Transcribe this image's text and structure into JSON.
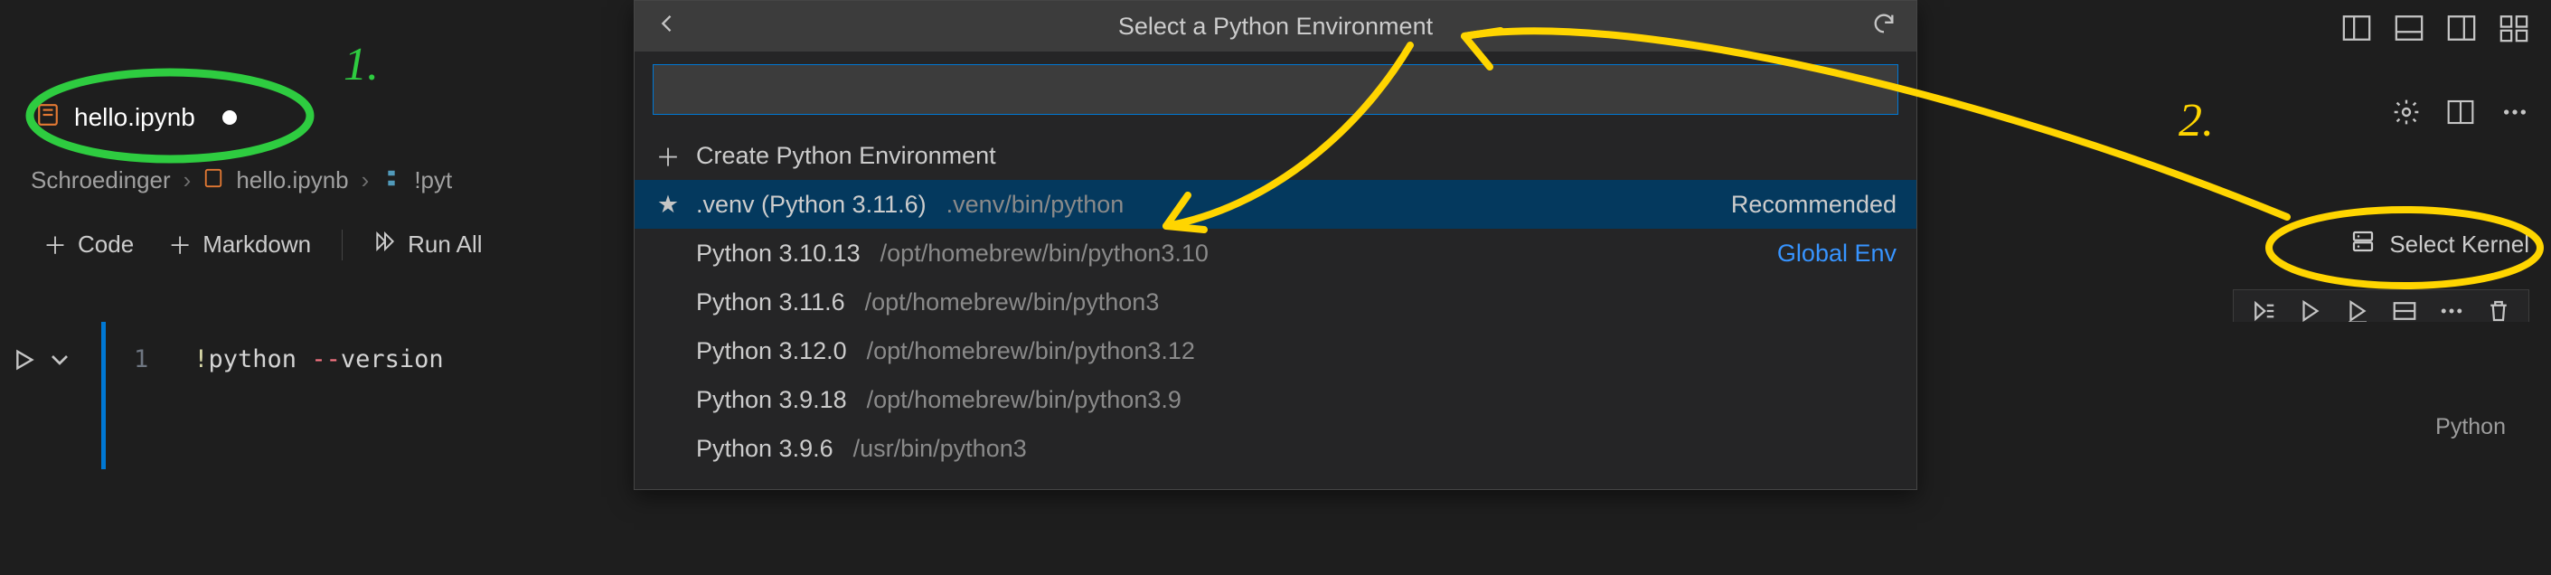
{
  "tab": {
    "filename": "hello.ipynb"
  },
  "breadcrumb": {
    "folder": "Schroedinger",
    "file": "hello.ipynb",
    "symbol_prefix": "!pyt"
  },
  "toolbar": {
    "code": "Code",
    "markdown": "Markdown",
    "run_all": "Run All",
    "select_kernel": "Select Kernel"
  },
  "cell": {
    "line_number": "1",
    "bang": "!",
    "cmd": "python ",
    "flag": "--",
    "rest": "version",
    "language": "Python"
  },
  "quickpick": {
    "title": "Select a Python Environment",
    "create_label": "Create Python Environment",
    "items": [
      {
        "label": ".venv (Python 3.11.6)",
        "desc": ".venv/bin/python",
        "badge": "Recommended",
        "badge_color": "white",
        "star": true
      },
      {
        "label": "Python 3.10.13",
        "desc": "/opt/homebrew/bin/python3.10",
        "badge": "Global Env",
        "badge_color": "blue"
      },
      {
        "label": "Python 3.11.6",
        "desc": "/opt/homebrew/bin/python3"
      },
      {
        "label": "Python 3.12.0",
        "desc": "/opt/homebrew/bin/python3.12"
      },
      {
        "label": "Python 3.9.18",
        "desc": "/opt/homebrew/bin/python3.9"
      },
      {
        "label": "Python 3.9.6",
        "desc": "/usr/bin/python3"
      }
    ]
  },
  "annotations": {
    "one": "1.",
    "two": "2."
  }
}
